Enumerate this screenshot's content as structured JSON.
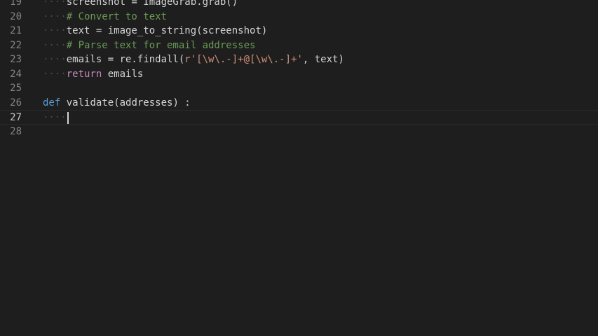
{
  "editor": {
    "lines": [
      {
        "number": "19",
        "indent": "····",
        "parts": [
          {
            "t": "screenshot = ImageGrab.grab()",
            "c": "fn"
          }
        ]
      },
      {
        "number": "20",
        "indent": "····",
        "parts": [
          {
            "t": "# Convert to text",
            "c": "cm"
          }
        ]
      },
      {
        "number": "21",
        "indent": "····",
        "parts": [
          {
            "t": "text = image_to_string(screenshot)",
            "c": "fn"
          }
        ]
      },
      {
        "number": "22",
        "indent": "····",
        "parts": [
          {
            "t": "# Parse text for email addresses",
            "c": "cm"
          }
        ]
      },
      {
        "number": "23",
        "indent": "····",
        "parts": [
          {
            "t": "emails = re.findall(",
            "c": "fn"
          },
          {
            "t": "r'[\\w\\.-]+@[\\w\\.-]+'",
            "c": "str"
          },
          {
            "t": ", text)",
            "c": "fn"
          }
        ]
      },
      {
        "number": "24",
        "indent": "····",
        "parts": [
          {
            "t": "return",
            "c": "kw2"
          },
          {
            "t": " emails",
            "c": "fn"
          }
        ]
      },
      {
        "number": "25",
        "indent": "",
        "parts": []
      },
      {
        "number": "26",
        "indent": "",
        "parts": [
          {
            "t": "def",
            "c": "kw"
          },
          {
            "t": " validate(addresses) :",
            "c": "fn"
          }
        ]
      },
      {
        "number": "27",
        "indent": "····",
        "parts": [],
        "current": true
      },
      {
        "number": "28",
        "indent": "",
        "parts": []
      }
    ]
  }
}
